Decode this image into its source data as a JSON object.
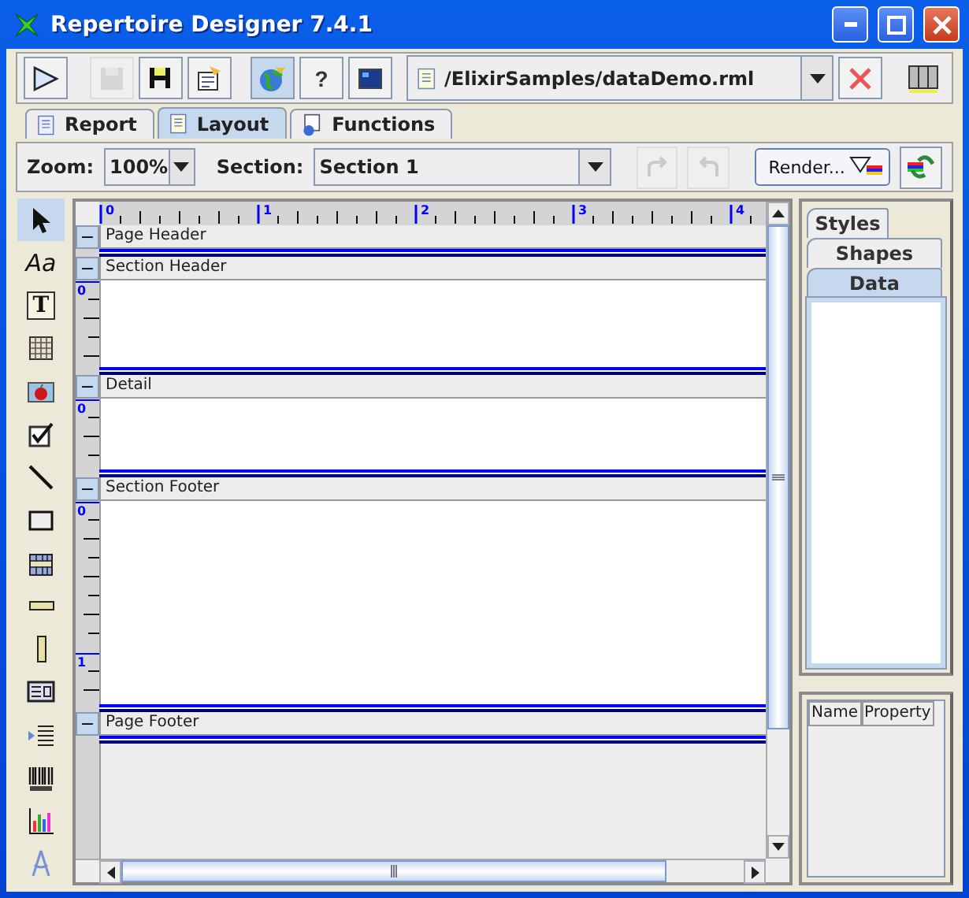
{
  "window": {
    "title": "Repertoire Designer 7.4.1"
  },
  "toolbar": {
    "buttons": [
      {
        "kind": "run",
        "disabled": false
      },
      {
        "kind": "save",
        "disabled": true
      },
      {
        "kind": "save-as",
        "disabled": false
      },
      {
        "kind": "properties",
        "disabled": false
      },
      {
        "kind": "globe",
        "disabled": false,
        "selected": true
      },
      {
        "kind": "help",
        "disabled": false,
        "glyph": "?"
      },
      {
        "kind": "screen",
        "disabled": false
      }
    ],
    "file_path": "/ElixirSamples/dataDemo.rml"
  },
  "tabs": [
    {
      "label": "Report",
      "selected": false
    },
    {
      "label": "Layout",
      "selected": true
    },
    {
      "label": "Functions",
      "selected": false
    }
  ],
  "layout_bar": {
    "zoom_label": "Zoom:",
    "zoom": "100%",
    "section_label": "Section:",
    "section": "Section 1",
    "redo_disabled": true,
    "undo_disabled": true,
    "render": "Render..."
  },
  "palette": [
    {
      "kind": "pointer",
      "selected": true
    },
    {
      "kind": "label",
      "selected": false,
      "glyph": "Aa"
    },
    {
      "kind": "text",
      "selected": false,
      "glyph": "T"
    },
    {
      "kind": "grid",
      "selected": false
    },
    {
      "kind": "image",
      "selected": false
    },
    {
      "kind": "checkbox",
      "selected": false
    },
    {
      "kind": "line",
      "selected": false
    },
    {
      "kind": "rectangle",
      "selected": false
    },
    {
      "kind": "table",
      "selected": false
    },
    {
      "kind": "hbar",
      "selected": false
    },
    {
      "kind": "vbar",
      "selected": false
    },
    {
      "kind": "form",
      "selected": false
    },
    {
      "kind": "list",
      "selected": false
    },
    {
      "kind": "barcode",
      "selected": false
    },
    {
      "kind": "chart",
      "selected": false
    },
    {
      "kind": "tool",
      "selected": false
    }
  ],
  "ruler": {
    "labels": [
      "0",
      "1",
      "2",
      "3",
      "4"
    ]
  },
  "sections": [
    {
      "toggle": "−",
      "name": "Page Header"
    },
    {
      "toggle": "−",
      "name": "Section Header",
      "ruler_labels": [
        "0"
      ]
    },
    {
      "toggle": "−",
      "name": "Detail",
      "ruler_labels": [
        "0"
      ]
    },
    {
      "toggle": "−",
      "name": "Section Footer",
      "ruler_labels": [
        "0",
        "1"
      ]
    },
    {
      "toggle": "−",
      "name": "Page Footer"
    }
  ],
  "side_tabs": [
    {
      "label": "Styles",
      "selected": false
    },
    {
      "label": "Shapes",
      "selected": false
    },
    {
      "label": "Data",
      "selected": true
    }
  ],
  "property_table": {
    "columns": [
      "Name",
      "Property"
    ]
  }
}
